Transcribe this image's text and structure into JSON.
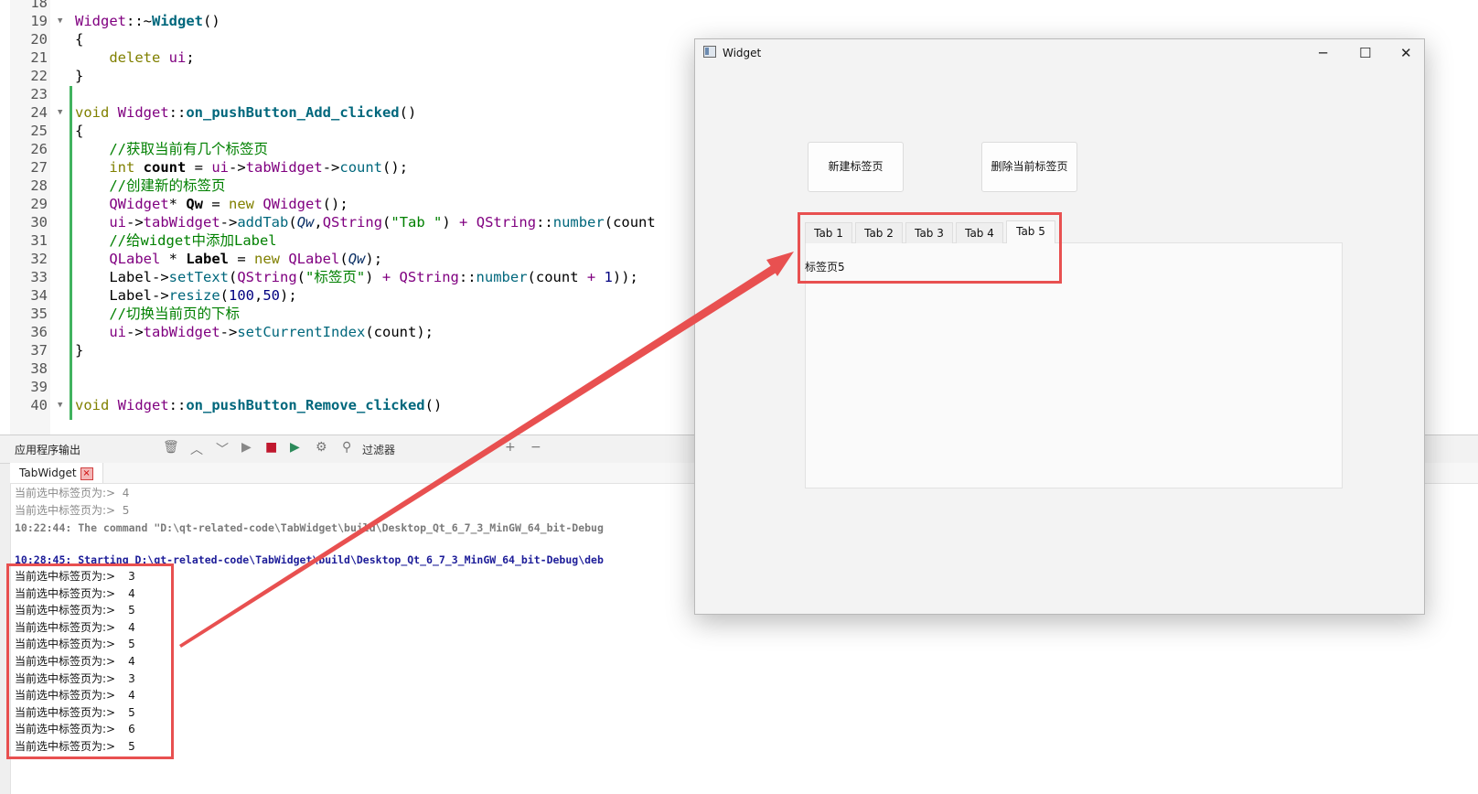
{
  "editor": {
    "lines": [
      {
        "n": "18",
        "fold": false,
        "segments": []
      },
      {
        "n": "19",
        "fold": true,
        "segments": [
          {
            "c": "ty",
            "t": "Widget"
          },
          {
            "c": "op",
            "t": "::~"
          },
          {
            "c": "fnb",
            "t": "Widget"
          },
          {
            "c": "op",
            "t": "()"
          }
        ]
      },
      {
        "n": "20",
        "fold": false,
        "segments": [
          {
            "c": "op",
            "t": "{"
          }
        ]
      },
      {
        "n": "21",
        "fold": false,
        "segments": [
          {
            "c": "op",
            "t": "    "
          },
          {
            "c": "kw",
            "t": "delete"
          },
          {
            "c": "op",
            "t": " "
          },
          {
            "c": "ty",
            "t": "ui"
          },
          {
            "c": "op",
            "t": ";"
          }
        ]
      },
      {
        "n": "22",
        "fold": false,
        "segments": [
          {
            "c": "op",
            "t": "}"
          }
        ]
      },
      {
        "n": "23",
        "fold": false,
        "segments": []
      },
      {
        "n": "24",
        "fold": true,
        "segments": [
          {
            "c": "kw",
            "t": "void"
          },
          {
            "c": "op",
            "t": " "
          },
          {
            "c": "ty",
            "t": "Widget"
          },
          {
            "c": "op",
            "t": "::"
          },
          {
            "c": "fnb",
            "t": "on_pushButton_Add_clicked"
          },
          {
            "c": "op",
            "t": "()"
          }
        ]
      },
      {
        "n": "25",
        "fold": false,
        "segments": [
          {
            "c": "op",
            "t": "{"
          }
        ]
      },
      {
        "n": "26",
        "fold": false,
        "segments": [
          {
            "c": "op",
            "t": "    "
          },
          {
            "c": "cm",
            "t": "//获取当前有几个标签页"
          }
        ]
      },
      {
        "n": "27",
        "fold": false,
        "segments": [
          {
            "c": "op",
            "t": "    "
          },
          {
            "c": "kw",
            "t": "int"
          },
          {
            "c": "op",
            "t": " "
          },
          {
            "c": "vb",
            "t": "count"
          },
          {
            "c": "op",
            "t": " = "
          },
          {
            "c": "ty",
            "t": "ui"
          },
          {
            "c": "op",
            "t": "->"
          },
          {
            "c": "ty",
            "t": "tabWidget"
          },
          {
            "c": "op",
            "t": "->"
          },
          {
            "c": "fn",
            "t": "count"
          },
          {
            "c": "op",
            "t": "();"
          }
        ]
      },
      {
        "n": "28",
        "fold": false,
        "segments": [
          {
            "c": "op",
            "t": "    "
          },
          {
            "c": "cm",
            "t": "//创建新的标签页"
          }
        ]
      },
      {
        "n": "29",
        "fold": false,
        "segments": [
          {
            "c": "op",
            "t": "    "
          },
          {
            "c": "ty",
            "t": "QWidget"
          },
          {
            "c": "op",
            "t": "* "
          },
          {
            "c": "vb",
            "t": "Qw"
          },
          {
            "c": "op",
            "t": " = "
          },
          {
            "c": "kw",
            "t": "new"
          },
          {
            "c": "op",
            "t": " "
          },
          {
            "c": "ty",
            "t": "QWidget"
          },
          {
            "c": "op",
            "t": "();"
          }
        ]
      },
      {
        "n": "30",
        "fold": false,
        "segments": [
          {
            "c": "op",
            "t": "    "
          },
          {
            "c": "ty",
            "t": "ui"
          },
          {
            "c": "op",
            "t": "->"
          },
          {
            "c": "ty",
            "t": "tabWidget"
          },
          {
            "c": "op",
            "t": "->"
          },
          {
            "c": "fn",
            "t": "addTab"
          },
          {
            "c": "op",
            "t": "("
          },
          {
            "c": "it",
            "t": "Qw"
          },
          {
            "c": "op",
            "t": ","
          },
          {
            "c": "ty",
            "t": "QString"
          },
          {
            "c": "op",
            "t": "("
          },
          {
            "c": "st",
            "t": "\"Tab \""
          },
          {
            "c": "op",
            "t": ") "
          },
          {
            "c": "ty",
            "t": "+"
          },
          {
            "c": "op",
            "t": " "
          },
          {
            "c": "ty",
            "t": "QString"
          },
          {
            "c": "op",
            "t": "::"
          },
          {
            "c": "fn",
            "t": "number"
          },
          {
            "c": "op",
            "t": "(count"
          }
        ]
      },
      {
        "n": "31",
        "fold": false,
        "segments": [
          {
            "c": "op",
            "t": "    "
          },
          {
            "c": "cm",
            "t": "//给widget中添加Label"
          }
        ]
      },
      {
        "n": "32",
        "fold": false,
        "segments": [
          {
            "c": "op",
            "t": "    "
          },
          {
            "c": "ty",
            "t": "QLabel"
          },
          {
            "c": "op",
            "t": " * "
          },
          {
            "c": "vb",
            "t": "Label"
          },
          {
            "c": "op",
            "t": " = "
          },
          {
            "c": "kw",
            "t": "new"
          },
          {
            "c": "op",
            "t": " "
          },
          {
            "c": "ty",
            "t": "QLabel"
          },
          {
            "c": "op",
            "t": "("
          },
          {
            "c": "it",
            "t": "Qw"
          },
          {
            "c": "op",
            "t": ");"
          }
        ]
      },
      {
        "n": "33",
        "fold": false,
        "segments": [
          {
            "c": "op",
            "t": "    "
          },
          {
            "c": "op",
            "t": "Label->"
          },
          {
            "c": "fn",
            "t": "setText"
          },
          {
            "c": "op",
            "t": "("
          },
          {
            "c": "ty",
            "t": "QString"
          },
          {
            "c": "op",
            "t": "("
          },
          {
            "c": "st",
            "t": "\"标签页\""
          },
          {
            "c": "op",
            "t": ") "
          },
          {
            "c": "ty",
            "t": "+"
          },
          {
            "c": "op",
            "t": " "
          },
          {
            "c": "ty",
            "t": "QString"
          },
          {
            "c": "op",
            "t": "::"
          },
          {
            "c": "fn",
            "t": "number"
          },
          {
            "c": "op",
            "t": "(count "
          },
          {
            "c": "ty",
            "t": "+"
          },
          {
            "c": "op",
            "t": " "
          },
          {
            "c": "nm",
            "t": "1"
          },
          {
            "c": "op",
            "t": "));"
          }
        ]
      },
      {
        "n": "34",
        "fold": false,
        "segments": [
          {
            "c": "op",
            "t": "    "
          },
          {
            "c": "op",
            "t": "Label->"
          },
          {
            "c": "fn",
            "t": "resize"
          },
          {
            "c": "op",
            "t": "("
          },
          {
            "c": "nm",
            "t": "100"
          },
          {
            "c": "op",
            "t": ","
          },
          {
            "c": "nm",
            "t": "50"
          },
          {
            "c": "op",
            "t": ");"
          }
        ]
      },
      {
        "n": "35",
        "fold": false,
        "segments": [
          {
            "c": "op",
            "t": "    "
          },
          {
            "c": "cm",
            "t": "//切换当前页的下标"
          }
        ]
      },
      {
        "n": "36",
        "fold": false,
        "segments": [
          {
            "c": "op",
            "t": "    "
          },
          {
            "c": "ty",
            "t": "ui"
          },
          {
            "c": "op",
            "t": "->"
          },
          {
            "c": "ty",
            "t": "tabWidget"
          },
          {
            "c": "op",
            "t": "->"
          },
          {
            "c": "fn",
            "t": "setCurrentIndex"
          },
          {
            "c": "op",
            "t": "(count);"
          }
        ]
      },
      {
        "n": "37",
        "fold": false,
        "segments": [
          {
            "c": "op",
            "t": "}"
          }
        ]
      },
      {
        "n": "38",
        "fold": false,
        "segments": []
      },
      {
        "n": "39",
        "fold": false,
        "segments": []
      },
      {
        "n": "40",
        "fold": true,
        "segments": [
          {
            "c": "kw",
            "t": "void"
          },
          {
            "c": "op",
            "t": " "
          },
          {
            "c": "ty",
            "t": "Widget"
          },
          {
            "c": "op",
            "t": "::"
          },
          {
            "c": "fnb",
            "t": "on_pushButton_Remove_clicked"
          },
          {
            "c": "op",
            "t": "()"
          }
        ]
      }
    ]
  },
  "output_pane": {
    "title": "应用程序输出",
    "filter_label": "过滤器",
    "icons": [
      "trash-icon",
      "up-arrow-icon",
      "down-arrow-icon",
      "run-icon",
      "stop-icon",
      "debug-run-icon",
      "gear-icon",
      "search-icon",
      "plus-icon",
      "minus-icon"
    ],
    "tab_label": "TabWidget",
    "old_lines": [
      "当前选中标签页为:>  4",
      "当前选中标签页为:>  5"
    ],
    "command_line": "10:22:44: The command \"D:\\qt-related-code\\TabWidget\\build\\Desktop_Qt_6_7_3_MinGW_64_bit-Debug",
    "starting_line": "10:28:45: Starting D:\\qt-related-code\\TabWidget\\build\\Desktop_Qt_6_7_3_MinGW_64_bit-Debug\\deb",
    "output_prefix": "当前选中标签页为:>",
    "output_values": [
      "3",
      "4",
      "5",
      "4",
      "5",
      "4",
      "3",
      "4",
      "5",
      "6",
      "5"
    ]
  },
  "qt_window": {
    "title": "Widget",
    "caption_buttons": {
      "minimize": "─",
      "maximize": "☐",
      "close": "✕"
    },
    "buttons": {
      "add": "新建标签页",
      "remove": "删除当前标签页"
    },
    "tabs": [
      "Tab 1",
      "Tab 2",
      "Tab 3",
      "Tab 4",
      "Tab 5"
    ],
    "active_tab_index": 4,
    "tab_content_label": "标签页5"
  },
  "colors": {
    "annotation_red": "#e85050",
    "modified_line_bar": "#41b35f"
  }
}
